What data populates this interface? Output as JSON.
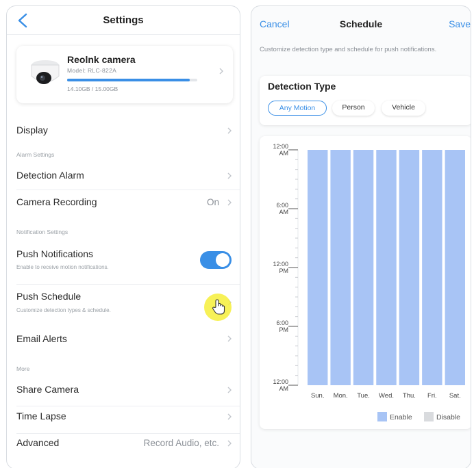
{
  "settings": {
    "title": "Settings",
    "camera": {
      "name": "Reolnk camera",
      "model": "Model: RLC-822A",
      "storage_text": "14.10GB / 15.00GB",
      "storage_fraction": 0.94
    },
    "display_label": "Display",
    "alarm_section": "Alarm Settings",
    "detection_alarm_label": "Detection Alarm",
    "camera_recording_label": "Camera Recording",
    "camera_recording_value": "On",
    "notification_section": "Notification Settings",
    "push_notifications_label": "Push Notifications",
    "push_notifications_sub": "Enable to receive motion notifications.",
    "push_notifications_on": true,
    "push_schedule_label": "Push Schedule",
    "push_schedule_sub": "Customize detection types & schedule.",
    "email_alerts_label": "Email Alerts",
    "more_section": "More",
    "share_camera_label": "Share Camera",
    "time_lapse_label": "Time Lapse",
    "advanced_label": "Advanced",
    "advanced_value": "Record Audio, etc."
  },
  "schedule": {
    "cancel_label": "Cancel",
    "title": "Schedule",
    "save_label": "Save",
    "description": "Customize detection type and schedule for push notifications.",
    "detection_type_title": "Detection Type",
    "detection_types": [
      "Any Motion",
      "Person",
      "Vehicle"
    ],
    "selected_detection_type": "Any Motion"
  },
  "chart_data": {
    "type": "bar",
    "categories": [
      "Sun.",
      "Mon.",
      "Tue.",
      "Wed.",
      "Thu.",
      "Fri.",
      "Sat."
    ],
    "y_tick_labels": [
      [
        "12:00",
        "AM"
      ],
      [
        "6:00",
        "AM"
      ],
      [
        "12:00",
        "PM"
      ],
      [
        "6:00",
        "PM"
      ],
      [
        "12:00",
        "AM"
      ]
    ],
    "y_range_hours": [
      0,
      24
    ],
    "series": [
      {
        "name": "Enable",
        "color": "#a8c4f5",
        "ranges": [
          [
            0,
            24
          ],
          [
            0,
            24
          ],
          [
            0,
            24
          ],
          [
            0,
            24
          ],
          [
            0,
            24
          ],
          [
            0,
            24
          ],
          [
            0,
            24
          ]
        ]
      }
    ],
    "legend": [
      {
        "label": "Enable",
        "color": "#a8c4f5"
      },
      {
        "label": "Disable",
        "color": "#d9dbde"
      }
    ],
    "legend_placement": "bottom-right"
  }
}
